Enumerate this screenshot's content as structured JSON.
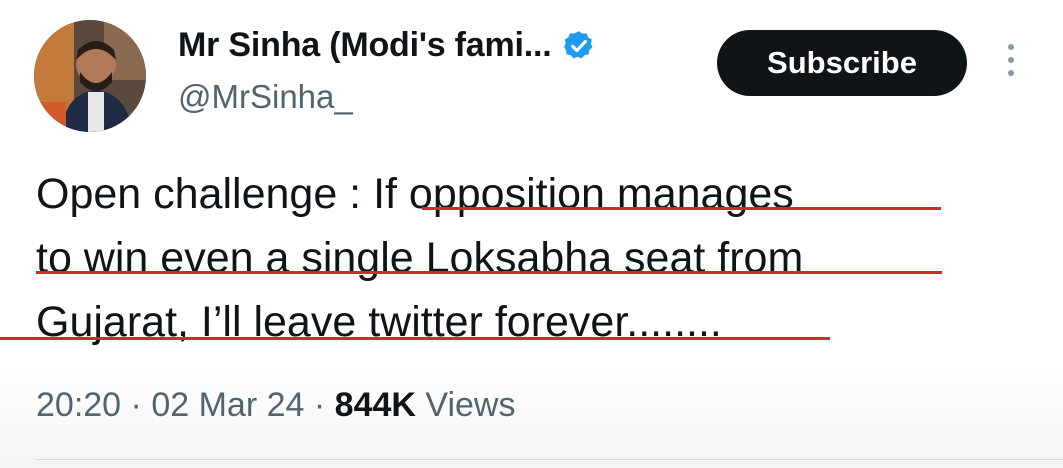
{
  "author": {
    "display_name": "Mr Sinha (Modi's fami...",
    "handle": "@MrSinha_",
    "verified": true,
    "avatar_icon": "profile-photo"
  },
  "actions": {
    "subscribe_label": "Subscribe",
    "more_icon": "vertical-ellipsis-icon"
  },
  "tweet": {
    "lines": [
      "Open challenge : If opposition manages",
      "to win even a single Loksabha seat from",
      "Gujarat, I’ll leave twitter forever........"
    ]
  },
  "meta": {
    "time": "20:20",
    "date": "02 Mar 24",
    "views_count": "844K",
    "views_label": "Views"
  },
  "colors": {
    "text": "#0f1419",
    "secondary_text": "#536471",
    "verified_badge": "#1d9bf0",
    "underline": "#d22a2a",
    "button_bg": "#0f1419"
  }
}
